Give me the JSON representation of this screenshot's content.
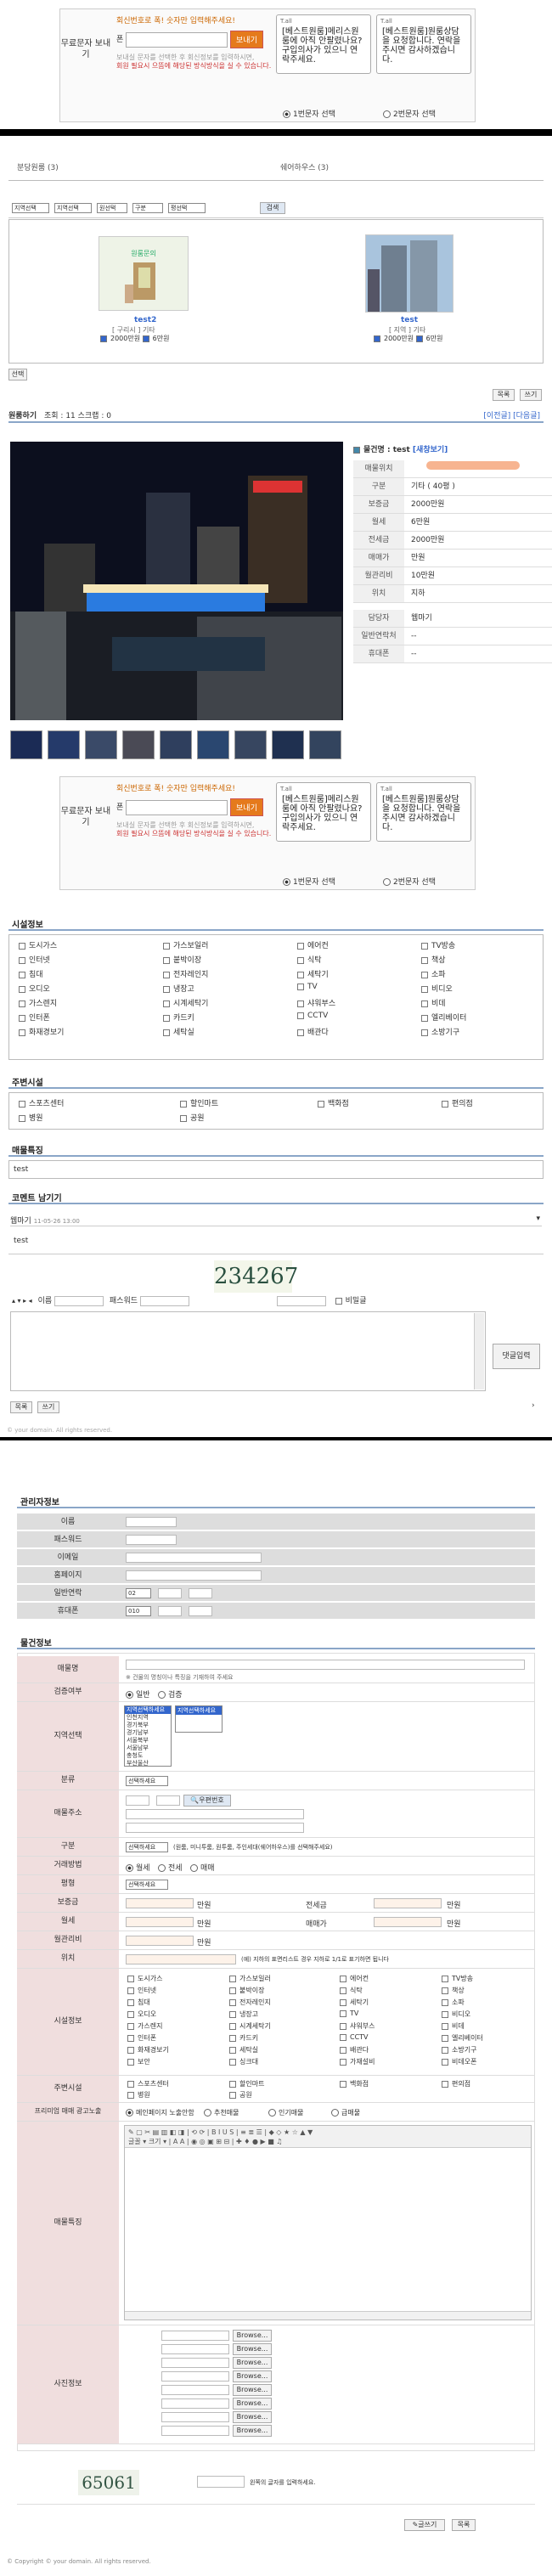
{
  "sms": {
    "label": "무료문자 보내기",
    "prompt": "회신번호로 폭! 숫자만 입력해주세요!",
    "to_label": "폰",
    "send": "보내기",
    "note": "보내실 문자를 선택한 후 회신정보를 입력하시면,",
    "warn": "회원 필요시 으뜸에 해당된 방식방식을 실 수 있습니다.",
    "phone_bar": "T.all",
    "msg1": "[베스트원룸]메리스원룸에 아직 안팔렸나요? 구입의사가 있으니 연락주세요.",
    "msg2": "[베스트원룸]원룸상담을 요청합니다. 연락을 주시면 감사하겠습니다.",
    "opt1": "1번문자 선택",
    "opt2": "2번문자 선택"
  },
  "listing": {
    "left_title": "분당원룸 (3)",
    "right_title": "쉐어하우스 (3)",
    "filters": [
      "지역선택",
      "지역선택",
      "원선택",
      "구분",
      "평선택"
    ],
    "search_btn": "검색",
    "item1": {
      "name": "test2",
      "sub": "[ 구리시 ] 기타",
      "price": "2000만원",
      "deposit": "6만원"
    },
    "item2": {
      "name": "test",
      "sub": "[ 지역 ] 기타",
      "price": "2000만원",
      "deposit": "6만원"
    },
    "small_btn": "선택",
    "btn_list": "목록",
    "btn_write": "쓰기"
  },
  "detail": {
    "header": "원룸하기",
    "views": "조회 : 11 스크랩 : 0",
    "prev_next": "[이전글] [다음글]",
    "prop_name_label": "물건명 : test",
    "new_link": "[새창보기]",
    "rows": [
      {
        "k": "매물위치",
        "v": ""
      },
      {
        "k": "구분",
        "v": "기타 ( 40평 )"
      },
      {
        "k": "보증금",
        "v": "2000만원"
      },
      {
        "k": "월세",
        "v": "6만원"
      },
      {
        "k": "전세금",
        "v": "2000만원"
      },
      {
        "k": "매매가",
        "v": "만원"
      },
      {
        "k": "월관리비",
        "v": "10만원"
      },
      {
        "k": "위치",
        "v": "지하"
      },
      {
        "k": "담당자",
        "v": "웹마기"
      },
      {
        "k": "일반연락처",
        "v": "--"
      },
      {
        "k": "휴대폰",
        "v": "--"
      }
    ]
  },
  "options": {
    "title": "시설정보",
    "items": [
      "도시가스",
      "가스보일러",
      "에어컨",
      "TV방송",
      "인터넷",
      "붙박이장",
      "식탁",
      "책상",
      "침대",
      "전자레인지",
      "세탁기",
      "소파",
      "오디오",
      "냉장고",
      "TV",
      "비디오",
      "가스렌지",
      "시계세탁기",
      "샤워부스",
      "비데",
      "인터폰",
      "카드키",
      "CCTV",
      "엘리베이터",
      "화재경보기",
      "세탁실",
      "배관다",
      "소방기구",
      "보안",
      "싱크대",
      "가재설비",
      "비데오폰"
    ]
  },
  "around": {
    "title": "주변시설",
    "items": [
      "스포츠센터",
      "할인마트",
      "백화점",
      "편의점",
      "병원",
      "공원"
    ]
  },
  "memo": {
    "title": "매물특징",
    "value": "test"
  },
  "comment": {
    "title": "코멘트 남기기",
    "entry_author": "웹마기",
    "entry_date": "11-05-26 13:00",
    "entry_text": "test",
    "name_label": "이름",
    "pw_label": "패스워드",
    "captcha": "234267",
    "secret_label": "비밀글",
    "submit": "댓글입력",
    "btn_list": "목록",
    "btn_write": "쓰기"
  },
  "footer1": "© your domain. All rights reserved.",
  "form": {
    "manager_title": "관리자정보",
    "manager_rows": [
      "이름",
      "패스워드",
      "이메일",
      "홈페이지",
      "일반연락",
      "휴대폰"
    ],
    "phone_sel": "02",
    "mobile_sel": "010",
    "prop_title": "물건정보",
    "rows": {
      "name": "매물명",
      "name_hint": "※ 건물의 명칭이나 특징을 기재하여 주세요",
      "type": "검증여부",
      "type_opts": [
        "일반",
        "검증"
      ],
      "region": "지역선택",
      "region_list": [
        "지역선택하세요",
        "인천지역",
        "경기북부",
        "경기남부",
        "서울북부",
        "서울남부",
        "충청도",
        "부산울산"
      ],
      "region_sel": "지역선택하세요",
      "kind": "분류",
      "kind_sel": "선택하세요",
      "addr": "매물주소",
      "addr_btn": "우편번호",
      "gubun": "구분",
      "gubun_sel": "선택하세요",
      "gubun_hint": "(원룸, 미니투룸, 원투룸, 주인세대(쉐어하우스)를 선택해주세요)",
      "deal": "거래방법",
      "deal_opts": [
        "월세",
        "전세",
        "매매"
      ],
      "floor": "평형",
      "floor_sel": "선택하세요",
      "deposit": "보증금",
      "jeonse": "전세금",
      "monthly": "월세",
      "sale": "매매가",
      "manage": "월관리비",
      "unit": "만원",
      "location": "위치",
      "location_hint": "(예) 지하의 표면리스트 경우 지하로 1/1로 표기하면 됩니다",
      "facilities": "시설정보",
      "around": "주변시설",
      "premium": "프리미엄 매매 광고노출",
      "premium_opts": [
        "메인페이지 노출안함",
        "추천매물",
        "인기매물",
        "급매물"
      ],
      "editor": "매물특징",
      "photo": "사진정보",
      "browse": "Browse..."
    },
    "captcha": "65061",
    "captcha_hint": "왼쪽의 글자를 입력하세요.",
    "submit": "글쓰기",
    "cancel": "목록"
  },
  "footer2": "© Copyright © your domain. All rights reserved."
}
